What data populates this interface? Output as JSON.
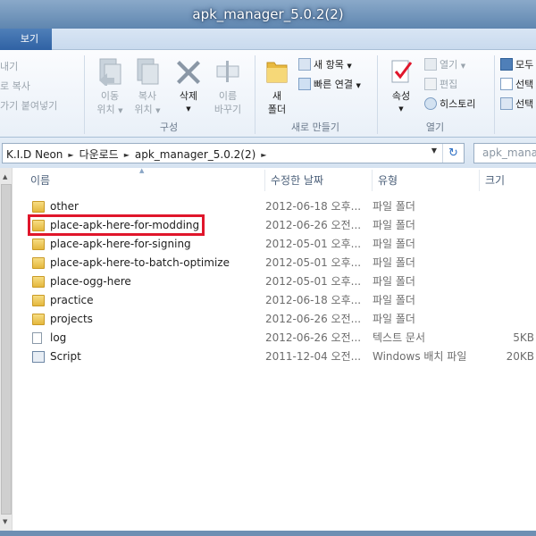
{
  "window": {
    "title": "apk_manager_5.0.2(2)"
  },
  "menu": {
    "view_tab": "보기"
  },
  "ribbon": {
    "clipboard": {
      "item1": "내기",
      "item2": "로 복사",
      "item3": "가기 붙여넣기"
    },
    "organize": {
      "move_l1": "이동",
      "move_l2": "위치",
      "copy_l1": "복사",
      "copy_l2": "위치",
      "delete_label": "삭제",
      "rename_l1": "이름",
      "rename_l2": "바꾸기",
      "group_label": "구성"
    },
    "new": {
      "folder_l1": "새",
      "folder_l2": "폴더",
      "new_item": "새 항목",
      "easy_access": "빠른 연결",
      "group_label": "새로 만들기"
    },
    "open": {
      "properties": "속성",
      "open": "열기",
      "edit": "편집",
      "history": "히스토리",
      "group_label": "열기"
    },
    "select": {
      "select_all": "모두",
      "select_none": "선택",
      "invert": "선택"
    }
  },
  "address": {
    "crumbs": [
      "K.I.D Neon",
      "다운로드",
      "apk_manager_5.0.2(2)"
    ],
    "search_placeholder": "apk_manag"
  },
  "columns": {
    "name": "이름",
    "modified": "수정한 날짜",
    "type": "유형",
    "size": "크기"
  },
  "files": [
    {
      "name": "other",
      "modified": "2012-06-18 오후...",
      "type": "파일 폴더",
      "size": "",
      "icon": "folder-icon"
    },
    {
      "name": "place-apk-here-for-modding",
      "modified": "2012-06-26 오전...",
      "type": "파일 폴더",
      "size": "",
      "icon": "folder-icon"
    },
    {
      "name": "place-apk-here-for-signing",
      "modified": "2012-05-01 오후...",
      "type": "파일 폴더",
      "size": "",
      "icon": "folder-icon"
    },
    {
      "name": "place-apk-here-to-batch-optimize",
      "modified": "2012-05-01 오후...",
      "type": "파일 폴더",
      "size": "",
      "icon": "folder-icon"
    },
    {
      "name": "place-ogg-here",
      "modified": "2012-05-01 오후...",
      "type": "파일 폴더",
      "size": "",
      "icon": "folder-icon"
    },
    {
      "name": "practice",
      "modified": "2012-06-18 오후...",
      "type": "파일 폴더",
      "size": "",
      "icon": "folder-icon"
    },
    {
      "name": "projects",
      "modified": "2012-06-26 오전...",
      "type": "파일 폴더",
      "size": "",
      "icon": "folder-icon"
    },
    {
      "name": "log",
      "modified": "2012-06-26 오전...",
      "type": "텍스트 문서",
      "size": "5KB",
      "icon": "text-file-icon"
    },
    {
      "name": "Script",
      "modified": "2011-12-04 오전...",
      "type": "Windows 배치 파일",
      "size": "20KB",
      "icon": "batch-file-icon"
    }
  ],
  "highlight_color": "#e0162b"
}
